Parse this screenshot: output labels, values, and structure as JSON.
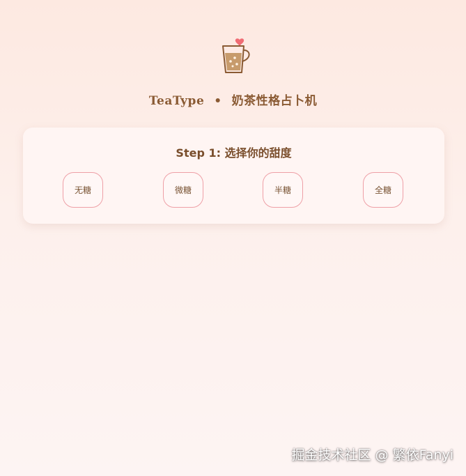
{
  "header": {
    "logo_icon": "milk-tea-cup-with-heart-icon",
    "brand": "TeaType",
    "separator": "•",
    "subtitle": "奶茶性格占卜机"
  },
  "step": {
    "title": "Step 1: 选择你的甜度",
    "options": [
      {
        "label": "无糖"
      },
      {
        "label": "微糖"
      },
      {
        "label": "半糖"
      },
      {
        "label": "全糖"
      }
    ]
  },
  "watermark": {
    "text": "掘金技术社区 @ 繁依Fanyi"
  },
  "colors": {
    "accent_border": "#ee9fa6",
    "heading_brown": "#8a5a33",
    "heart": "#f06c74",
    "card_bg": "#fff5f3"
  }
}
